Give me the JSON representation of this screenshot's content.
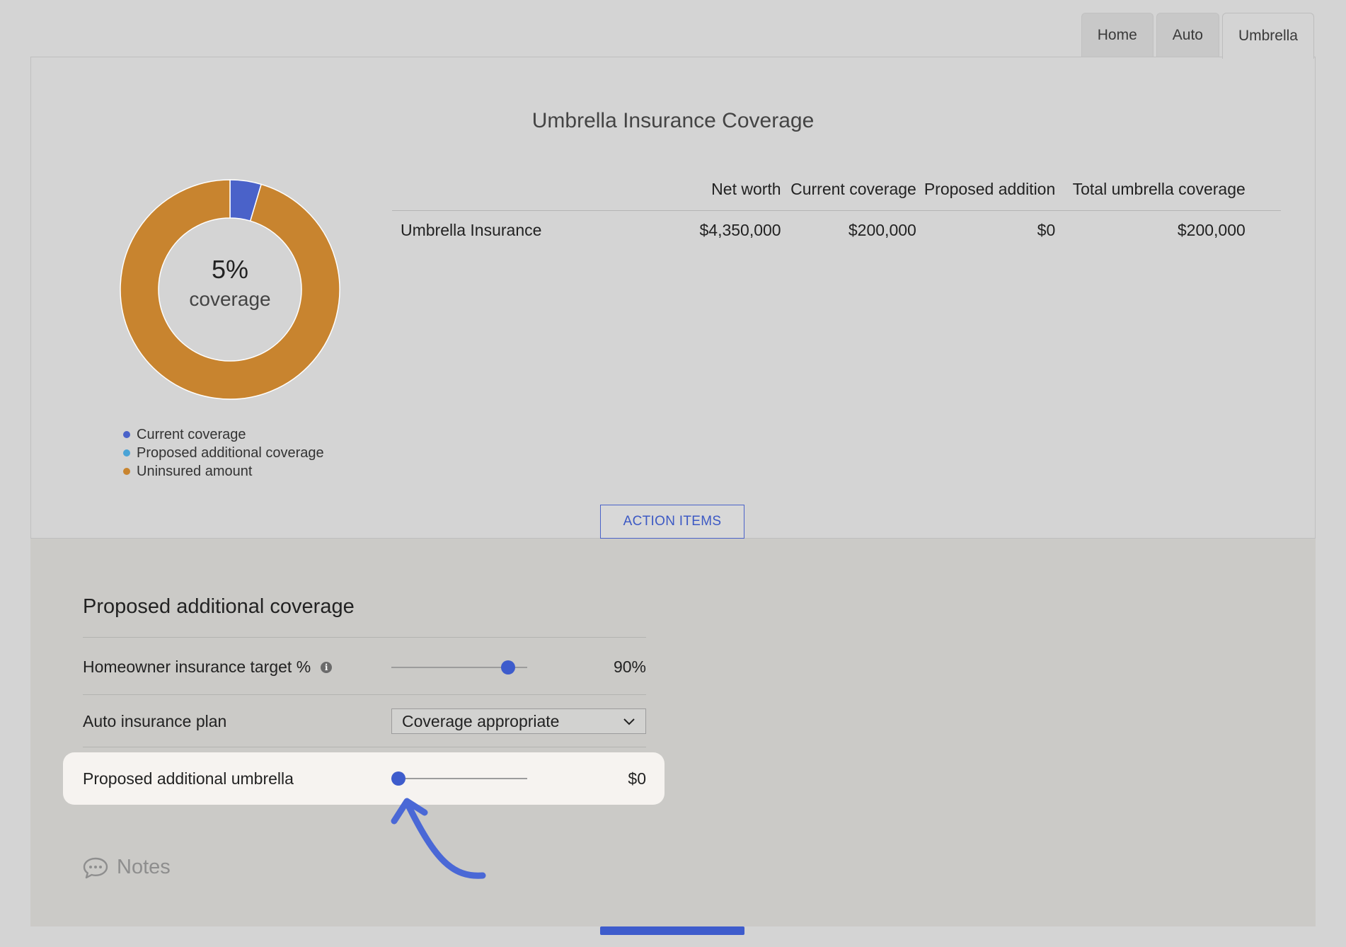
{
  "tabs": [
    {
      "label": "Home",
      "active": false
    },
    {
      "label": "Auto",
      "active": false
    },
    {
      "label": "Umbrella",
      "active": true
    }
  ],
  "chart": {
    "title": "Umbrella Insurance Coverage",
    "center_percent": "5%",
    "center_label": "coverage"
  },
  "chart_data": {
    "type": "pie",
    "variant": "donut",
    "title": "Umbrella Insurance Coverage",
    "categories": [
      "Current coverage",
      "Proposed additional coverage",
      "Uninsured amount"
    ],
    "values": [
      200000,
      0,
      4150000
    ],
    "colors": [
      "#4a62c9",
      "#4aa3d6",
      "#c8842f"
    ],
    "legend": "bottom-left"
  },
  "legend": [
    {
      "label": "Current coverage",
      "color": "#4a62c9"
    },
    {
      "label": "Proposed additional coverage",
      "color": "#4aa3d6"
    },
    {
      "label": "Uninsured amount",
      "color": "#c8842f"
    }
  ],
  "table": {
    "headers": [
      "",
      "Net worth",
      "Current coverage",
      "Proposed addition",
      "Total umbrella coverage"
    ],
    "rows": [
      [
        "Umbrella Insurance",
        "$4,350,000",
        "$200,000",
        "$0",
        "$200,000"
      ]
    ]
  },
  "action_items_label": "ACTION ITEMS",
  "proposed": {
    "title": "Proposed additional coverage",
    "homeowner": {
      "label": "Homeowner insurance target %",
      "value": "90%",
      "slider_fraction": 0.9
    },
    "auto": {
      "label": "Auto insurance plan",
      "selected": "Coverage appropriate"
    },
    "umbrella": {
      "label": "Proposed additional umbrella",
      "value": "$0",
      "slider_fraction": 0
    }
  },
  "notes_label": "Notes",
  "colors": {
    "accent": "#3e5ccc",
    "uninsured": "#c8842f"
  }
}
